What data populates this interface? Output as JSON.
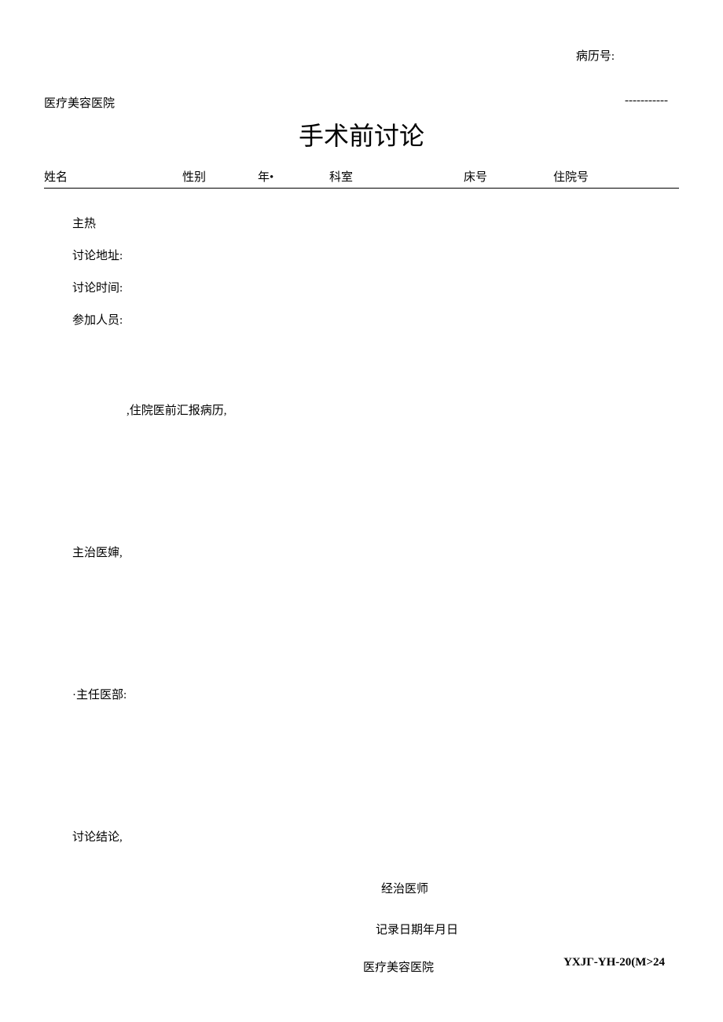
{
  "header": {
    "record_no_label": "病历号:",
    "hospital_name": "医疗美容医院",
    "dashed_mark": "-----------"
  },
  "title": "手术前讨论",
  "columns": {
    "name": "姓名",
    "gender": "性别",
    "age": "年•",
    "dept": "科室",
    "bed": "床号",
    "admission": "住院号"
  },
  "fields": {
    "host_label": "主热",
    "address_label": "讨论地址:",
    "time_label": "讨论时间:",
    "participants_label": "参加人员:"
  },
  "sections": {
    "resident_report": ",住院医前汇报病历,",
    "attending": "主治医婶,",
    "chief": "·主任医部:",
    "conclusion": "讨论结论,"
  },
  "footer": {
    "physician_label": "经治医师",
    "record_date_label": "记录日期年月日",
    "hospital_name": "医疗美容医院",
    "code": "YXJГ-YH-20(M>24"
  }
}
